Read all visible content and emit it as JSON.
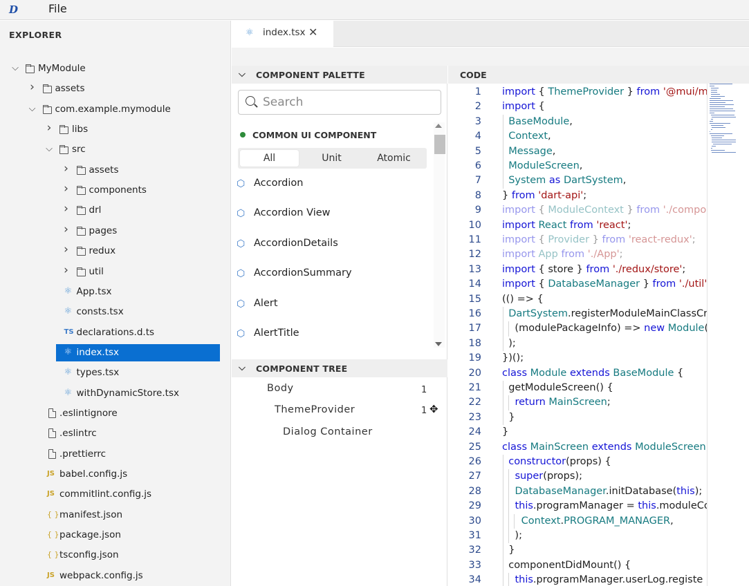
{
  "menubar": {
    "logo": "D",
    "file_label": "File"
  },
  "explorer": {
    "title": "EXPLORER",
    "tree": [
      {
        "label": "MyModule",
        "kind": "folder",
        "depth": 0,
        "expanded": true
      },
      {
        "label": "assets",
        "kind": "folder",
        "depth": 1,
        "expanded": false
      },
      {
        "label": "com.example.mymodule",
        "kind": "folder",
        "depth": 1,
        "expanded": true
      },
      {
        "label": "libs",
        "kind": "folder",
        "depth": 2,
        "expanded": false
      },
      {
        "label": "src",
        "kind": "folder",
        "depth": 2,
        "expanded": true
      },
      {
        "label": "assets",
        "kind": "folder",
        "depth": 3,
        "expanded": false
      },
      {
        "label": "components",
        "kind": "folder",
        "depth": 3,
        "expanded": false
      },
      {
        "label": "drl",
        "kind": "folder",
        "depth": 3,
        "expanded": false
      },
      {
        "label": "pages",
        "kind": "folder",
        "depth": 3,
        "expanded": false
      },
      {
        "label": "redux",
        "kind": "folder",
        "depth": 3,
        "expanded": false
      },
      {
        "label": "util",
        "kind": "folder",
        "depth": 3,
        "expanded": false
      },
      {
        "label": "App.tsx",
        "kind": "react",
        "depth": 3
      },
      {
        "label": "consts.tsx",
        "kind": "react",
        "depth": 3
      },
      {
        "label": "declarations.d.ts",
        "kind": "ts",
        "depth": 3
      },
      {
        "label": "index.tsx",
        "kind": "react",
        "depth": 3,
        "selected": true
      },
      {
        "label": "types.tsx",
        "kind": "react",
        "depth": 3
      },
      {
        "label": "withDynamicStore.tsx",
        "kind": "react",
        "depth": 3
      },
      {
        "label": ".eslintignore",
        "kind": "file",
        "depth": 2
      },
      {
        "label": ".eslintrc",
        "kind": "file",
        "depth": 2
      },
      {
        "label": ".prettierrc",
        "kind": "file",
        "depth": 2
      },
      {
        "label": "babel.config.js",
        "kind": "js",
        "depth": 2
      },
      {
        "label": "commitlint.config.js",
        "kind": "js",
        "depth": 2
      },
      {
        "label": "manifest.json",
        "kind": "json",
        "depth": 2
      },
      {
        "label": "package.json",
        "kind": "json",
        "depth": 2
      },
      {
        "label": "tsconfig.json",
        "kind": "json",
        "depth": 2
      },
      {
        "label": "webpack.config.js",
        "kind": "js",
        "depth": 2
      }
    ],
    "icon_text": {
      "ts": "TS",
      "js": "JS",
      "json": "{ }"
    }
  },
  "tabs": [
    {
      "label": "index.tsx",
      "active": true
    }
  ],
  "palette": {
    "header": "COMPONENT PALETTE",
    "search_placeholder": "Search",
    "group_label": "COMMON UI COMPONENT",
    "filters": [
      "All",
      "Unit",
      "Atomic"
    ],
    "active_filter": "All",
    "items": [
      "Accordion",
      "Accordion View",
      "AccordionDetails",
      "AccordionSummary",
      "Alert",
      "AlertTitle"
    ]
  },
  "component_tree": {
    "header": "COMPONENT TREE",
    "nodes": [
      {
        "label": "Body",
        "count": "1"
      },
      {
        "label": "ThemeProvider",
        "count": "1"
      },
      {
        "label": "Dialog Container",
        "count": ""
      }
    ]
  },
  "code": {
    "header": "CODE",
    "lines": [
      [
        [
          "kw",
          "import "
        ],
        [
          "pl",
          "{ "
        ],
        [
          "ty",
          "ThemeProvider"
        ],
        [
          "pl",
          " } "
        ],
        [
          "kw",
          "from "
        ],
        [
          "st",
          "'@mui/m"
        ]
      ],
      [
        [
          "kw",
          "import "
        ],
        [
          "pl",
          "{"
        ]
      ],
      [
        [
          "pl",
          "  "
        ],
        [
          "ty",
          "BaseModule"
        ],
        [
          "pl",
          ","
        ]
      ],
      [
        [
          "pl",
          "  "
        ],
        [
          "ty",
          "Context"
        ],
        [
          "pl",
          ","
        ]
      ],
      [
        [
          "pl",
          "  "
        ],
        [
          "ty",
          "Message"
        ],
        [
          "pl",
          ","
        ]
      ],
      [
        [
          "pl",
          "  "
        ],
        [
          "ty",
          "ModuleScreen"
        ],
        [
          "pl",
          ","
        ]
      ],
      [
        [
          "pl",
          "  "
        ],
        [
          "ty",
          "System"
        ],
        [
          "kw",
          " as "
        ],
        [
          "ty",
          "DartSystem"
        ],
        [
          "pl",
          ","
        ]
      ],
      [
        [
          "pl",
          "} "
        ],
        [
          "kw",
          "from "
        ],
        [
          "st",
          "'dart-api'"
        ],
        [
          "pl",
          ";"
        ]
      ],
      [
        [
          "kw",
          "import "
        ],
        [
          "pl",
          "{ "
        ],
        [
          "ty",
          "ModuleContext"
        ],
        [
          "pl",
          " } "
        ],
        [
          "kw",
          "from "
        ],
        [
          "st",
          "'./compo"
        ]
      ],
      [
        [
          "kw",
          "import "
        ],
        [
          "ty",
          "React "
        ],
        [
          "kw",
          "from "
        ],
        [
          "st",
          "'react'"
        ],
        [
          "pl",
          ";"
        ]
      ],
      [
        [
          "kw",
          "import "
        ],
        [
          "pl",
          "{ "
        ],
        [
          "ty",
          "Provider"
        ],
        [
          "pl",
          " } "
        ],
        [
          "kw",
          "from "
        ],
        [
          "st",
          "'react-redux'"
        ],
        [
          "pl",
          ";"
        ]
      ],
      [
        [
          "kw",
          "import "
        ],
        [
          "ty",
          "App "
        ],
        [
          "kw",
          "from "
        ],
        [
          "st",
          "'./App'"
        ],
        [
          "pl",
          ";"
        ]
      ],
      [
        [
          "kw",
          "import "
        ],
        [
          "pl",
          "{ store } "
        ],
        [
          "kw",
          "from "
        ],
        [
          "st",
          "'./redux/store'"
        ],
        [
          "pl",
          ";"
        ]
      ],
      [
        [
          "kw",
          "import "
        ],
        [
          "pl",
          "{ "
        ],
        [
          "ty",
          "DatabaseManager"
        ],
        [
          "pl",
          " } "
        ],
        [
          "kw",
          "from "
        ],
        [
          "st",
          "'./util'"
        ],
        [
          "pl",
          ";"
        ]
      ],
      [
        [
          "pl",
          "(() => {"
        ]
      ],
      [
        [
          "pl",
          "  "
        ],
        [
          "ty",
          "DartSystem"
        ],
        [
          "pl",
          ".registerModuleMainClassCr"
        ]
      ],
      [
        [
          "pl",
          "    (modulePackageInfo) => "
        ],
        [
          "kw",
          "new "
        ],
        [
          "ty",
          "Module"
        ],
        [
          "pl",
          "(r"
        ]
      ],
      [
        [
          "pl",
          "  );"
        ]
      ],
      [
        [
          "pl",
          "})();"
        ]
      ],
      [
        [
          "kw",
          "class "
        ],
        [
          "ty",
          "Module "
        ],
        [
          "kw",
          "extends "
        ],
        [
          "ty",
          "BaseModule"
        ],
        [
          "pl",
          " {"
        ]
      ],
      [
        [
          "pl",
          "  getModuleScreen() {"
        ]
      ],
      [
        [
          "pl",
          "    "
        ],
        [
          "kw",
          "return "
        ],
        [
          "ty",
          "MainScreen"
        ],
        [
          "pl",
          ";"
        ]
      ],
      [
        [
          "pl",
          "  }"
        ]
      ],
      [
        [
          "pl",
          "}"
        ]
      ],
      [
        [
          "kw",
          "class "
        ],
        [
          "ty",
          "MainScreen "
        ],
        [
          "kw",
          "extends "
        ],
        [
          "ty",
          "ModuleScreen"
        ]
      ],
      [
        [
          "pl",
          "  "
        ],
        [
          "kw",
          "constructor"
        ],
        [
          "pl",
          "(props) {"
        ]
      ],
      [
        [
          "pl",
          "    "
        ],
        [
          "kw",
          "super"
        ],
        [
          "pl",
          "(props);"
        ]
      ],
      [
        [
          "pl",
          "    "
        ],
        [
          "ty",
          "DatabaseManager"
        ],
        [
          "pl",
          ".initDatabase("
        ],
        [
          "kw",
          "this"
        ],
        [
          "pl",
          ");"
        ]
      ],
      [
        [
          "pl",
          "    "
        ],
        [
          "kw",
          "this"
        ],
        [
          "pl",
          ".programManager = "
        ],
        [
          "kw",
          "this"
        ],
        [
          "pl",
          ".moduleCo"
        ]
      ],
      [
        [
          "pl",
          "      "
        ],
        [
          "ty",
          "Context"
        ],
        [
          "pl",
          "."
        ],
        [
          "ty",
          "PROGRAM_MANAGER"
        ],
        [
          "pl",
          ","
        ]
      ],
      [
        [
          "pl",
          "    );"
        ]
      ],
      [
        [
          "pl",
          "  }"
        ]
      ],
      [
        [
          "pl",
          "  componentDidMount() {"
        ]
      ],
      [
        [
          "pl",
          "    "
        ],
        [
          "kw",
          "this"
        ],
        [
          "pl",
          ".programManager.userLog.registe"
        ]
      ]
    ],
    "faded_lines": [
      9,
      11,
      12
    ]
  },
  "colors": {
    "selection": "#0a6fd1",
    "keyword": "#1414d6",
    "type": "#167a80",
    "string": "#a31515",
    "line_number": "#2c4a8c"
  }
}
